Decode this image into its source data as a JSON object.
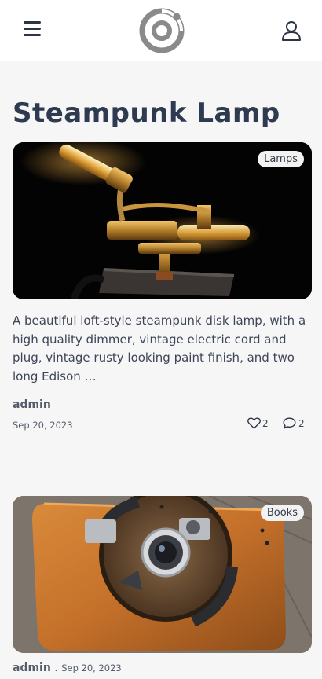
{
  "header": {
    "menu_icon": "hamburger-icon",
    "logo_icon": "ring-logo-icon",
    "user_icon": "user-icon"
  },
  "page": {
    "title": "Steampunk Lamp"
  },
  "posts": [
    {
      "category": "Lamps",
      "excerpt": "A beautiful loft-style steampunk disk lamp, with a high quality dimmer, vintage electric cord and plug, vintage rusty looking paint finish, and two long Edison …",
      "author": "admin",
      "date": "Sep 20, 2023",
      "likes": "2",
      "comments": "2"
    },
    {
      "category": "Books",
      "author": "admin",
      "separator": ".",
      "date": "Sep 20, 2023"
    }
  ]
}
